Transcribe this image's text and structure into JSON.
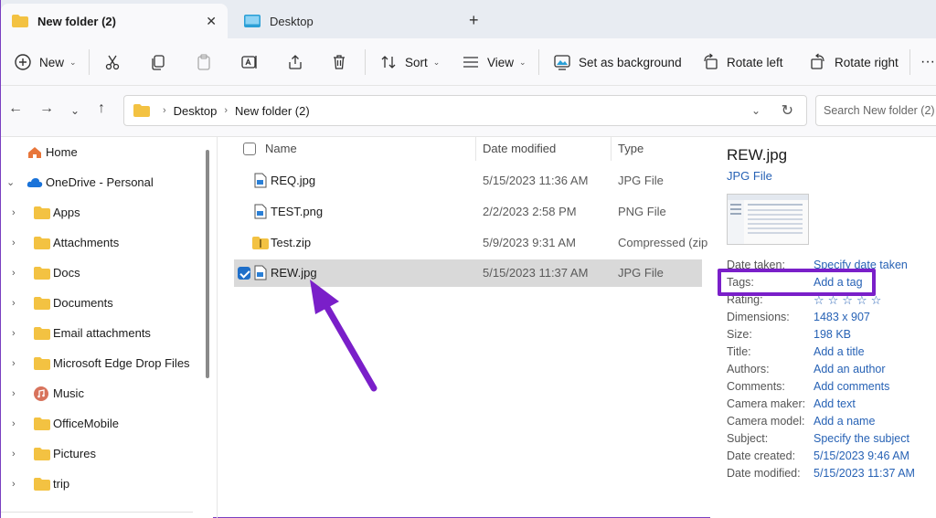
{
  "tabs": {
    "active_label": "New folder (2)",
    "inactive_label": "Desktop",
    "add_label": "+",
    "close_label": "✕"
  },
  "toolbar": {
    "new_label": "New",
    "sort_label": "Sort",
    "view_label": "View",
    "set_bg_label": "Set as background",
    "rotate_left_label": "Rotate left",
    "rotate_right_label": "Rotate right",
    "more_label": "···"
  },
  "address": {
    "crumbs": [
      "Desktop",
      "New folder (2)"
    ],
    "search_placeholder": "Search New folder (2)"
  },
  "sidebar": {
    "items": [
      {
        "label": "Home",
        "icon": "home-icon"
      },
      {
        "label": "OneDrive - Personal",
        "icon": "cloud-icon"
      },
      {
        "label": "Apps",
        "icon": "folder-icon"
      },
      {
        "label": "Attachments",
        "icon": "folder-icon"
      },
      {
        "label": "Docs",
        "icon": "folder-icon"
      },
      {
        "label": "Documents",
        "icon": "folder-icon"
      },
      {
        "label": "Email attachments",
        "icon": "folder-icon"
      },
      {
        "label": "Microsoft Edge Drop Files",
        "icon": "folder-icon"
      },
      {
        "label": "Music",
        "icon": "music-icon"
      },
      {
        "label": "OfficeMobile",
        "icon": "folder-icon"
      },
      {
        "label": "Pictures",
        "icon": "folder-icon"
      },
      {
        "label": "trip",
        "icon": "folder-icon"
      }
    ]
  },
  "filelist": {
    "headers": {
      "name": "Name",
      "date": "Date modified",
      "type": "Type"
    },
    "rows": [
      {
        "name": "REQ.jpg",
        "date": "5/15/2023 11:36 AM",
        "type": "JPG File",
        "selected": false
      },
      {
        "name": "TEST.png",
        "date": "2/2/2023 2:58 PM",
        "type": "PNG File",
        "selected": false
      },
      {
        "name": "Test.zip",
        "date": "5/9/2023 9:31 AM",
        "type": "Compressed (zip",
        "selected": false
      },
      {
        "name": "REW.jpg",
        "date": "5/15/2023 11:37 AM",
        "type": "JPG File",
        "selected": true
      }
    ]
  },
  "details": {
    "title": "REW.jpg",
    "subtitle": "JPG File",
    "props": [
      {
        "key": "Date taken:",
        "value": "Specify date taken",
        "link": true
      },
      {
        "key": "Tags:",
        "value": "Add a tag",
        "link": true
      },
      {
        "key": "Rating:",
        "value": "☆☆☆☆☆",
        "link": false
      },
      {
        "key": "Dimensions:",
        "value": "1483 x 907",
        "link": true
      },
      {
        "key": "Size:",
        "value": "198 KB",
        "link": true
      },
      {
        "key": "Title:",
        "value": "Add a title",
        "link": true
      },
      {
        "key": "Authors:",
        "value": "Add an author",
        "link": true
      },
      {
        "key": "Comments:",
        "value": "Add comments",
        "link": true
      },
      {
        "key": "Camera maker:",
        "value": "Add text",
        "link": true
      },
      {
        "key": "Camera model:",
        "value": "Add a name",
        "link": true
      },
      {
        "key": "Subject:",
        "value": "Specify the subject",
        "link": true
      },
      {
        "key": "Date created:",
        "value": "5/15/2023 9:46 AM",
        "link": true
      },
      {
        "key": "Date modified:",
        "value": "5/15/2023 11:37 AM",
        "link": true
      }
    ]
  },
  "colors": {
    "accent": "#1f6fc9",
    "highlight": "#7a1fc9",
    "link": "#2762b5",
    "folder": "#f3c242"
  }
}
